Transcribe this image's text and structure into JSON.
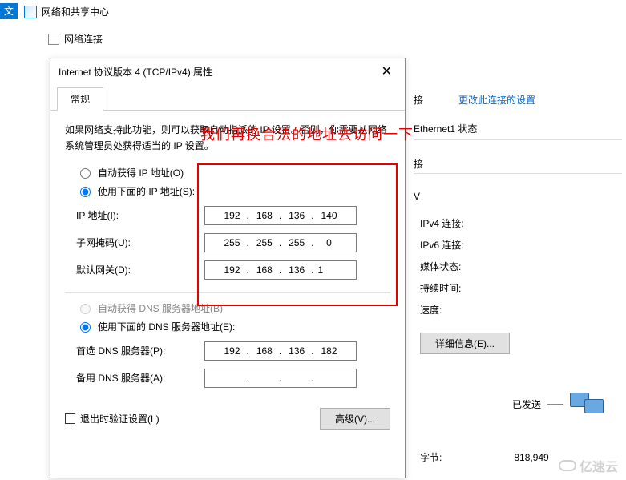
{
  "top": {
    "blue_char": "文",
    "label1": "网络",
    "header_title": "网络和共享中心",
    "sub_title": "网络连接"
  },
  "dialog": {
    "title": "Internet 协议版本 4 (TCP/IPv4) 属性",
    "tab_general": "常规",
    "description": "如果网络支持此功能，则可以获取自动指派的 IP 设置。否则，你需要从网络系统管理员处获得适当的 IP 设置。",
    "radio_auto_ip": "自动获得 IP 地址(O)",
    "radio_use_ip": "使用下面的 IP 地址(S):",
    "ip_label": "IP 地址(I):",
    "ip": {
      "a": "192",
      "b": "168",
      "c": "136",
      "d": "140"
    },
    "mask_label": "子网掩码(U):",
    "mask": {
      "a": "255",
      "b": "255",
      "c": "255",
      "d": "0"
    },
    "gw_label": "默认网关(D):",
    "gw": {
      "a": "192",
      "b": "168",
      "c": "136",
      "d": "1"
    },
    "radio_auto_dns": "自动获得 DNS 服务器地址(B)",
    "radio_use_dns": "使用下面的 DNS 服务器地址(E):",
    "dns1_label": "首选 DNS 服务器(P):",
    "dns1": {
      "a": "192",
      "b": "168",
      "c": "136",
      "d": "182"
    },
    "dns2_label": "备用 DNS 服务器(A):",
    "dns2": {
      "a": "",
      "b": "",
      "c": "",
      "d": ""
    },
    "exit_validate": "退出时验证设置(L)",
    "advanced_btn": "高级(V)..."
  },
  "annotation": {
    "text": "我们再换合法的地址去访问一下"
  },
  "right": {
    "jie": "接",
    "link_change": "更改此连接的设置",
    "status_title": "Ethernet1 状态",
    "jie2": "接",
    "v": "V",
    "ipv4": "IPv4 连接:",
    "ipv6": "IPv6 连接:",
    "media": "媒体状态:",
    "duration": "持续时间:",
    "speed": "速度:",
    "detail_btn": "详细信息(E)...",
    "sent": "已发送",
    "bytes_label": "字节:",
    "bytes_val": "818,949"
  },
  "watermark": "亿速云"
}
